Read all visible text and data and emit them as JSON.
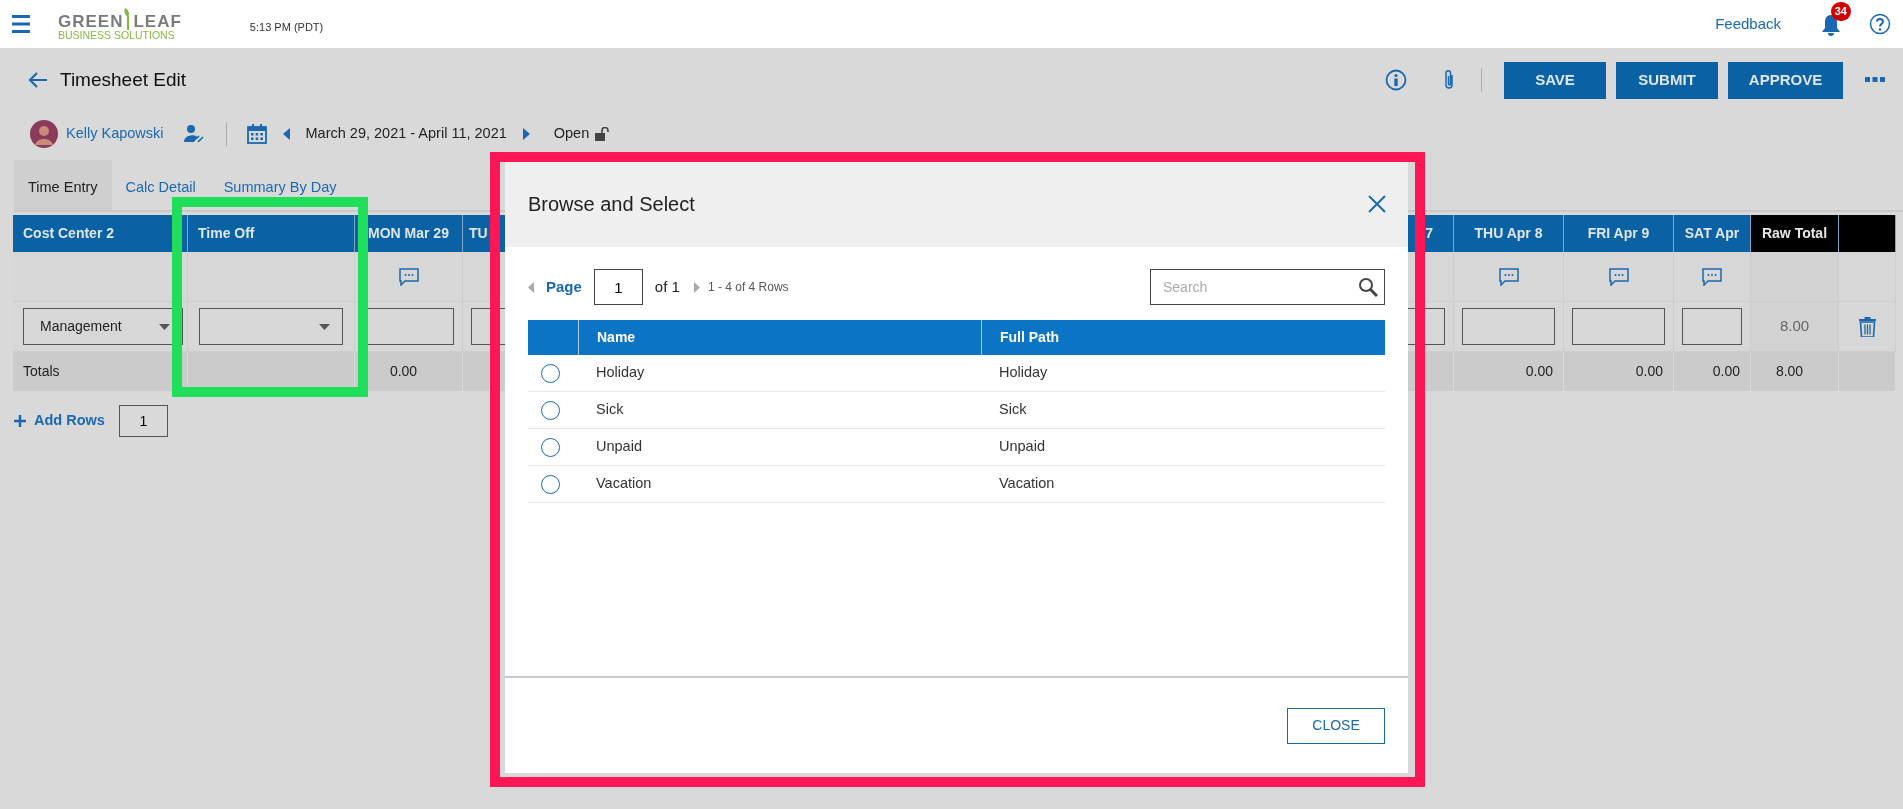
{
  "topbar": {
    "logo_word_1": "GREEN",
    "logo_word_2": "LEAF",
    "logo_tagline": "BUSINESS SOLUTIONS",
    "time": "5:13 PM (PDT)",
    "feedback": "Feedback",
    "notification_count": "34"
  },
  "page": {
    "title": "Timesheet Edit",
    "buttons": [
      "SAVE",
      "SUBMIT",
      "APPROVE"
    ]
  },
  "employee": {
    "name": "Kelly Kapowski",
    "period": "March 29, 2021 - April 11, 2021",
    "status": "Open"
  },
  "tabs": [
    {
      "label": "Time Entry",
      "selected": true
    },
    {
      "label": "Calc Detail",
      "selected": false
    },
    {
      "label": "Summary By Day",
      "selected": false
    }
  ],
  "grid": {
    "columns": [
      {
        "kind": "select",
        "label": "Cost Center 2",
        "value": "Management",
        "total": "Totals"
      },
      {
        "kind": "select",
        "label": "Time Off"
      },
      {
        "kind": "day",
        "label": "MON Mar 29",
        "comment": true,
        "total": "0.00"
      },
      {
        "kind": "day",
        "label": "TU"
      },
      {
        "kind": "covered"
      },
      {
        "kind": "day",
        "label": "7"
      },
      {
        "kind": "day",
        "label": "THU Apr 8",
        "comment": true,
        "total": "0.00"
      },
      {
        "kind": "day",
        "label": "FRI Apr 9",
        "comment": true,
        "total": "0.00"
      },
      {
        "kind": "day",
        "label": "SAT Apr",
        "comment": true,
        "total": "0.00"
      },
      {
        "kind": "total",
        "label": "Raw Total",
        "value": "8.00",
        "total": "8.00"
      },
      {
        "kind": "action"
      }
    ],
    "add_rows": {
      "label": "Add Rows",
      "value": "1"
    }
  },
  "modal": {
    "title": "Browse and Select",
    "page_label": "Page",
    "page": "1",
    "page_of": "of 1",
    "rows_info": "1 - 4 of 4 Rows",
    "search_placeholder": "Search",
    "columns": [
      "Name",
      "Full Path"
    ],
    "rows": [
      {
        "name": "Holiday",
        "path": "Holiday",
        "selected": false
      },
      {
        "name": "Sick",
        "path": "Sick",
        "selected": false
      },
      {
        "name": "Unpaid",
        "path": "Unpaid",
        "selected": false
      },
      {
        "name": "Vacation",
        "path": "Vacation",
        "selected": false
      }
    ],
    "close": "CLOSE"
  },
  "annotations": [
    {
      "color": "#ff1654"
    },
    {
      "color": "#1ede5a"
    }
  ]
}
